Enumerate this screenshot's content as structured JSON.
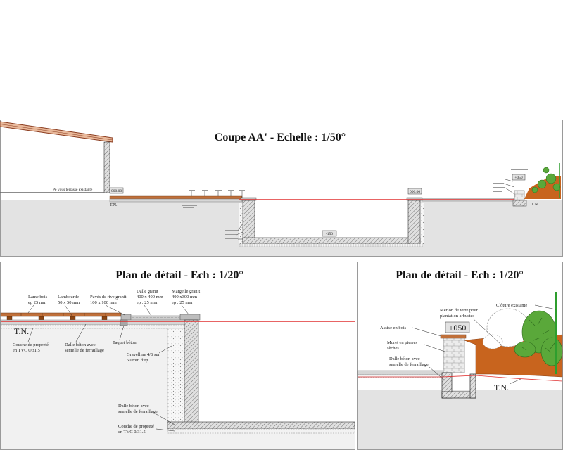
{
  "colors": {
    "deck_wood": "#c0703a",
    "tn_red": "#e03030",
    "mound_earth": "#c8641e",
    "plant_green": "#5aa83a",
    "fence_green": "#2e9e2e",
    "ground_grey": "#e3e3e3"
  },
  "section_aa": {
    "title": "Coupe AA' - Echelle : 1/50°",
    "terrace_label": "Pé vous terrasse existante",
    "level_house": "000.00",
    "level_pool_edge": "000.00",
    "level_pool_bottom": "-150",
    "level_mound": "+050",
    "tn_left": "T.N.",
    "tn_right": "T.N."
  },
  "detail_pool_edge": {
    "title": "Plan de détail - Ech : 1/20°",
    "tn": "T.N.",
    "lame_bois": [
      "Lame bois",
      "ep 25 mm"
    ],
    "lambourde": [
      "Lambourde",
      "50 x 50 mm"
    ],
    "paves_rive": [
      "Pavés de rive granit",
      "100 x 100 mm"
    ],
    "dalle_granit": [
      "Dalle granit",
      "400 x 400 mm",
      "ep : 25 mm"
    ],
    "margelle": [
      "Margelle granit",
      "400 x300 mm",
      "ep : 25 mm"
    ],
    "couche_haut": [
      "Couche de propreté",
      "en TVC 0/31.5"
    ],
    "dalle_beton_haut": [
      "Dalle béton avec",
      "semelle de ferraillage"
    ],
    "taquet": "Taquet béton",
    "gravelline": [
      "Gravelline 4/6 sur",
      "50 mm d'ep"
    ],
    "dalle_beton_fond": [
      "Dalle béton avec",
      "semelle de ferraillage"
    ],
    "couche_fond": [
      "Couche de propreté",
      "en TVC 0/31.5"
    ]
  },
  "detail_fence": {
    "title": "Plan de détail - Ech : 1/20°",
    "cloture": "Clôture existante",
    "merlon": [
      "Merlon de terre pour",
      "plantation arbustes"
    ],
    "level": "+050",
    "assise": "Assise en bois",
    "muret": [
      "Muret en pierres",
      "sèches"
    ],
    "dalle_beton": [
      "Dalle béton avec",
      "semelle de ferraillage"
    ],
    "tn": "T.N."
  }
}
